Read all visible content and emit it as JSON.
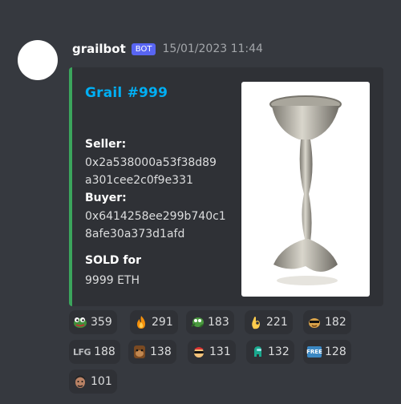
{
  "message": {
    "username": "grailbot",
    "bot_tag": "BOT",
    "timestamp": "15/01/2023 11:44"
  },
  "embed": {
    "title": "Grail #999",
    "accent_color": "#3ba55c",
    "title_color": "#00aff4",
    "seller_label": "Seller:",
    "seller_line1": "0x2a538000a53f38d89",
    "seller_line2": "a301cee2c0f9e331",
    "buyer_label": "Buyer:",
    "buyer_line1": "0x6414258ee299b740c1",
    "buyer_line2": "8afe30a373d1afd",
    "sold_label": "SOLD for",
    "sold_value": "9999 ETH",
    "thumbnail": "silver-grail-chalice-image"
  },
  "reactions": [
    {
      "emoji": "pepe-frog-emoji",
      "count": "359"
    },
    {
      "emoji": "fire-emoji",
      "count": "291"
    },
    {
      "emoji": "pepe-running-emoji",
      "count": "183"
    },
    {
      "emoji": "ok-hand-emoji",
      "count": "221"
    },
    {
      "emoji": "cool-doge-emoji",
      "count": "182"
    },
    {
      "emoji": "lfg-emoji",
      "label": "LFG",
      "count": "188"
    },
    {
      "emoji": "ape-face-emoji",
      "count": "138"
    },
    {
      "emoji": "sunglasses-character-emoji",
      "count": "131"
    },
    {
      "emoji": "among-us-crewmate-emoji",
      "count": "132"
    },
    {
      "emoji": "free-button-emoji",
      "label": "FREE",
      "count": "128"
    },
    {
      "emoji": "man-face-emoji",
      "count": "101"
    }
  ]
}
